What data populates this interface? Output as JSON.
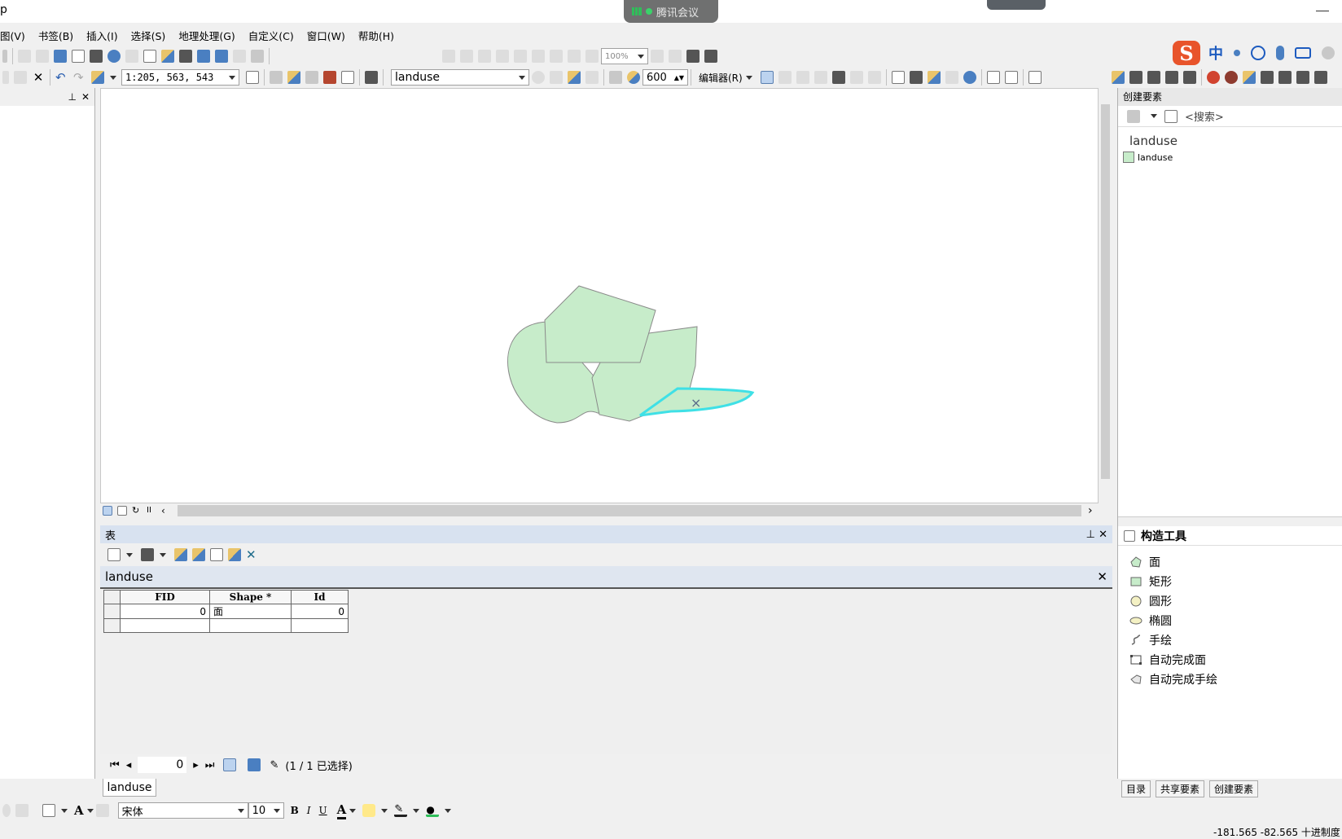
{
  "window": {
    "title_fragment": "p",
    "meeting_label": "腾讯会议"
  },
  "menu": [
    "图(V)",
    "书签(B)",
    "插入(I)",
    "选择(S)",
    "地理处理(G)",
    "自定义(C)",
    "窗口(W)",
    "帮助(H)"
  ],
  "toolbar": {
    "zoom_percent": "100%",
    "scale": "1:205, 563, 543",
    "target_layer": "landuse",
    "snap_value": "600",
    "editor_label": "编辑器(R)"
  },
  "ime": {
    "logo": "S",
    "lang": "中"
  },
  "right_panel": {
    "title": "创建要素",
    "search_placeholder": "<搜索>",
    "layer_group": "landuse",
    "layer_item": "landuse",
    "construct_title": "构造工具",
    "construct_tools": [
      "面",
      "矩形",
      "圆形",
      "椭圆",
      "手绘",
      "自动完成面",
      "自动完成手绘"
    ],
    "tabs": [
      "目录",
      "共享要素",
      "创建要素"
    ]
  },
  "table": {
    "window_title": "表",
    "name": "landuse",
    "columns": [
      "FID",
      "Shape *",
      "Id"
    ],
    "rows": [
      [
        "0",
        "面",
        "0"
      ]
    ],
    "current_record": "0",
    "selection_status": "(1 / 1 已选择)",
    "tab_label": "landuse"
  },
  "bottom_toolbar": {
    "font_name": "宋体",
    "font_size": "10",
    "bold": "B",
    "italic": "I",
    "underline": "U",
    "font_color_letter": "A"
  },
  "status": {
    "coords": "-181.565  -82.565 十进制度"
  },
  "colors": {
    "polygon_fill": "#c7ecca",
    "selection_outline": "#3fe0e6",
    "accent": "#4a7fc1"
  }
}
